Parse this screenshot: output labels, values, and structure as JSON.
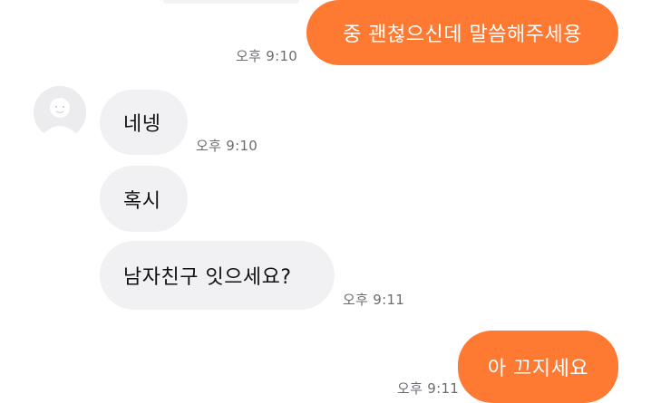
{
  "messages": [
    {
      "id": "m1",
      "direction": "sent",
      "text": "중 괜첞으신데 말씀해주세용",
      "time": "오후 9:10"
    },
    {
      "id": "m2",
      "direction": "received",
      "text": "네넹",
      "time": "오후 9:10"
    },
    {
      "id": "m3",
      "direction": "received",
      "text": "혹시",
      "time": ""
    },
    {
      "id": "m4",
      "direction": "received",
      "text": "남자친구 잇으세요?",
      "time": "오후 9:11"
    },
    {
      "id": "m5",
      "direction": "sent",
      "text": "아 끄지세요",
      "time": "오후 9:11"
    }
  ],
  "colors": {
    "sent_bubble": "#fe7a33",
    "received_bubble": "#f1f1f4",
    "time_text": "#6b6b73",
    "background": "#ffffff"
  },
  "avatar": {
    "icon": "default-profile-icon"
  }
}
